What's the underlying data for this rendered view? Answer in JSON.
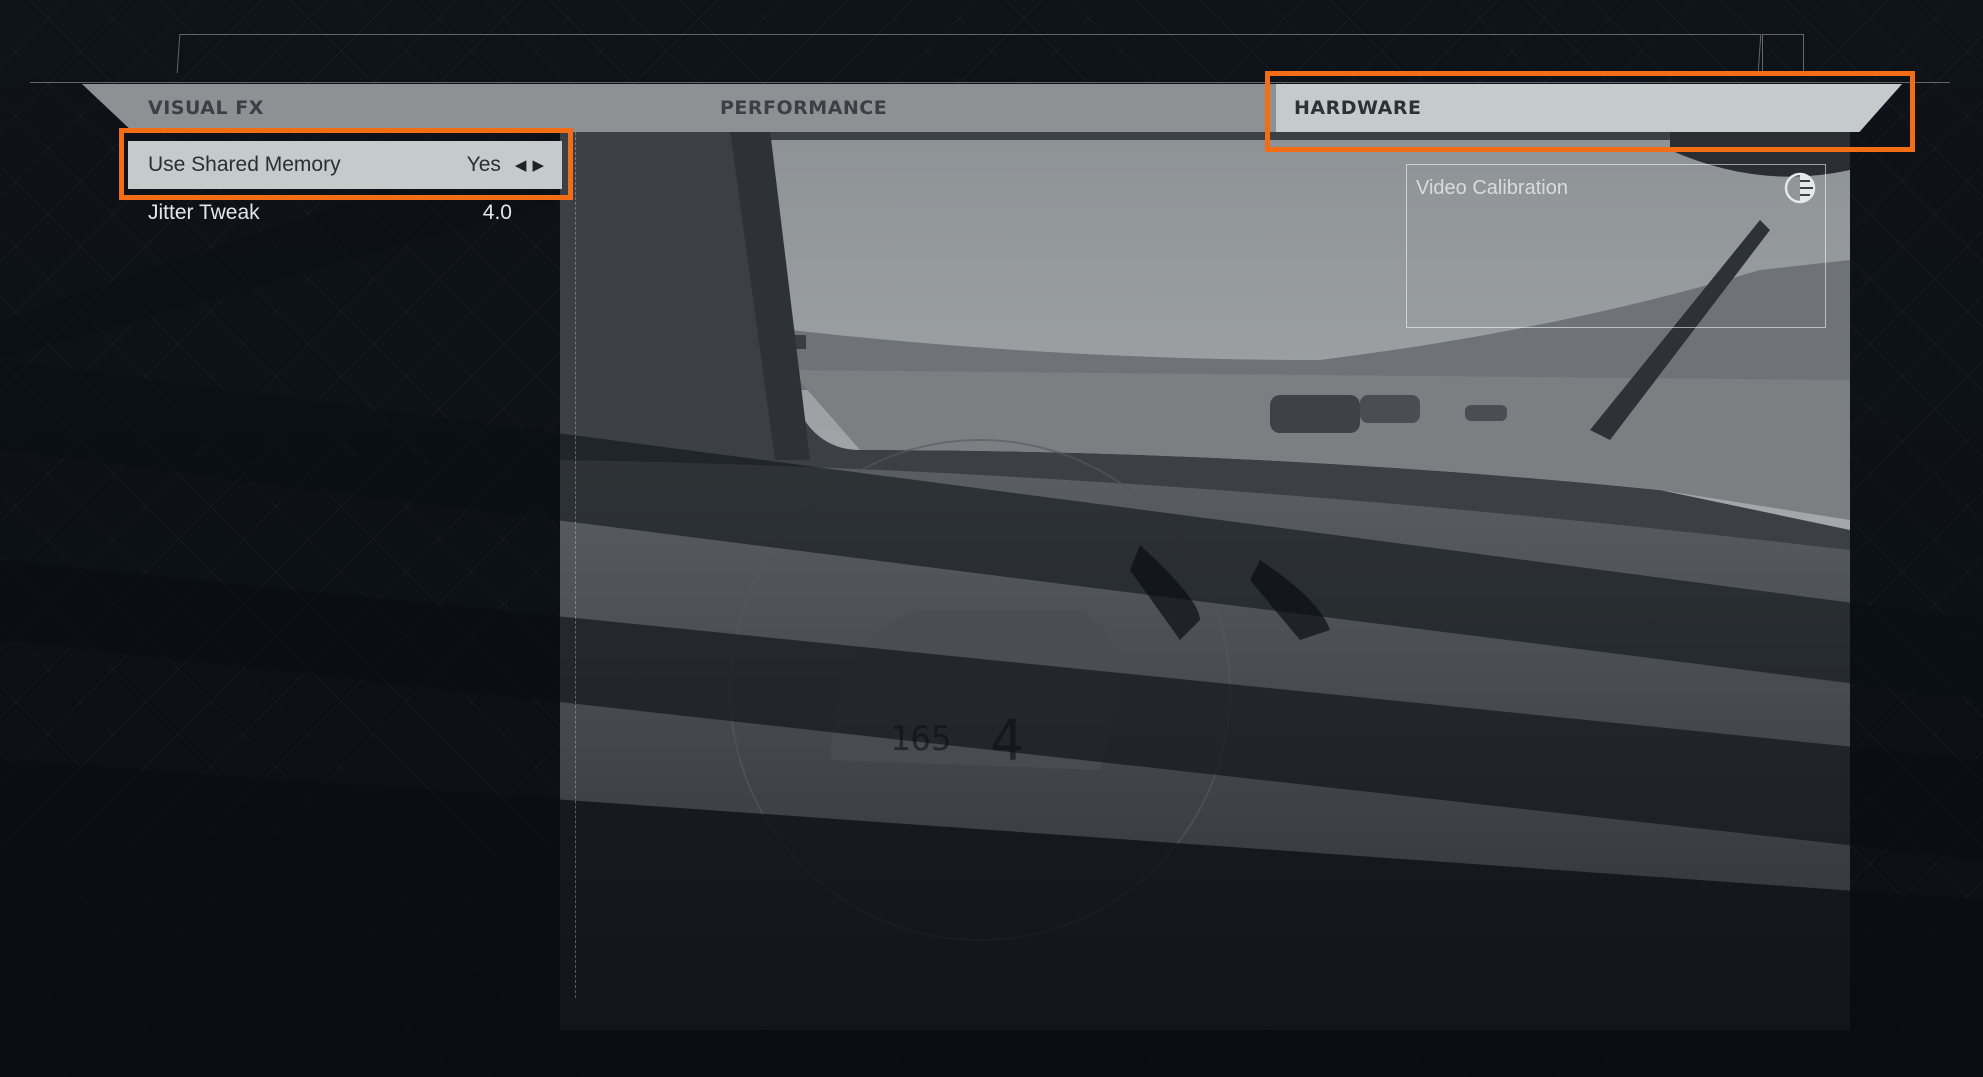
{
  "tabs": [
    {
      "label": "VISUAL FX",
      "active": false
    },
    {
      "label": "PERFORMANCE",
      "active": false
    },
    {
      "label": "HARDWARE",
      "active": true
    }
  ],
  "settings": [
    {
      "label": "Use Shared Memory",
      "value": "Yes",
      "selected": true
    },
    {
      "label": "Jitter Tweak",
      "value": "4.0",
      "selected": false
    }
  ],
  "calibration": {
    "label": "Video Calibration",
    "icon": "contrast-icon"
  },
  "dashboard": {
    "speed": "165",
    "gear": "4"
  },
  "colors": {
    "highlight": "#f36d16",
    "tab_bar": "#8e9193",
    "tab_active": "#c5cacb",
    "background": "#0c1015"
  }
}
